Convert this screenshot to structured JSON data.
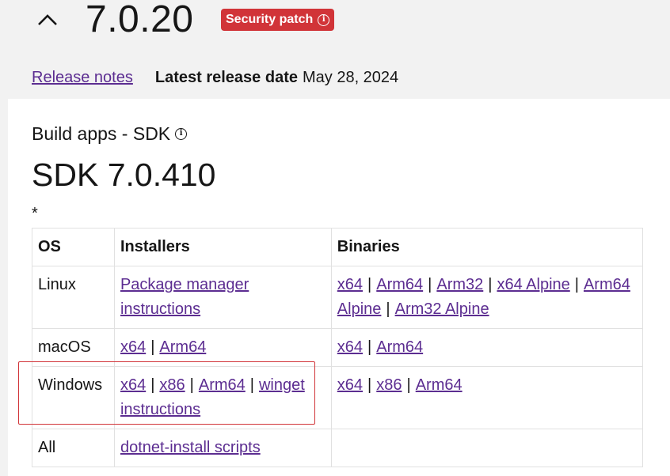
{
  "header": {
    "version": "7.0.20",
    "badge_label": "Security patch",
    "release_notes_link": "Release notes",
    "latest_release_label": "Latest release date",
    "latest_release_date": "May 28, 2024"
  },
  "sdk": {
    "section_title": "Build apps - SDK",
    "title": "SDK 7.0.410",
    "footnote_mark": "*",
    "table": {
      "headers": [
        "OS",
        "Installers",
        "Binaries"
      ],
      "rows": [
        {
          "os": "Linux",
          "installers": [
            "Package manager instructions"
          ],
          "binaries": [
            "x64",
            "Arm64",
            "Arm32",
            "x64 Alpine",
            "Arm64 Alpine",
            "Arm32 Alpine"
          ]
        },
        {
          "os": "macOS",
          "installers": [
            "x64",
            "Arm64"
          ],
          "binaries": [
            "x64",
            "Arm64"
          ]
        },
        {
          "os": "Windows",
          "installers": [
            "x64",
            "x86",
            "Arm64",
            "winget instructions"
          ],
          "binaries": [
            "x64",
            "x86",
            "Arm64"
          ]
        },
        {
          "os": "All",
          "installers": [
            "dotnet-install scripts"
          ],
          "binaries": []
        }
      ]
    }
  },
  "colors": {
    "link": "#5c2d91",
    "badge": "#d13438",
    "highlight": "#d13438",
    "background": "#f2f2f2"
  },
  "icons": {
    "collapse": "chevron-up-icon",
    "info": "info-icon"
  }
}
